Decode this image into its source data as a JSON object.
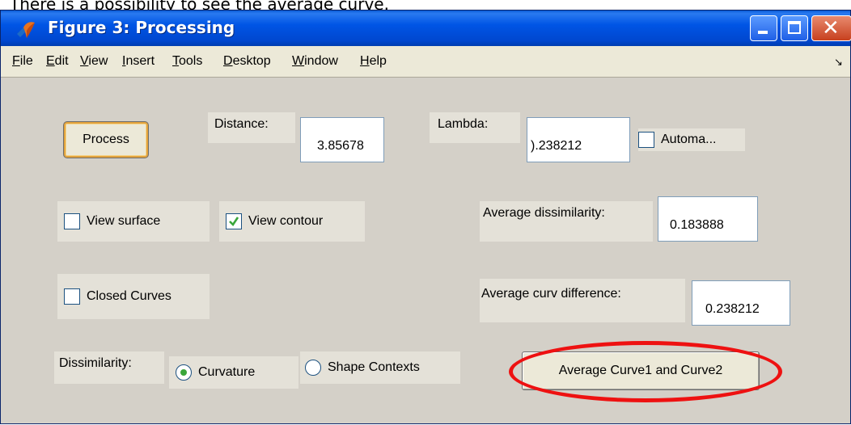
{
  "caption": "There is a possibility to see the average curve.",
  "window": {
    "title": "Figure 3: Processing",
    "controls": {
      "minimize": "minimize",
      "maximize": "maximize",
      "close": "close"
    }
  },
  "menu": [
    {
      "text": "File",
      "underline": "F",
      "rest": "ile"
    },
    {
      "text": "Edit",
      "underline": "E",
      "rest": "dit"
    },
    {
      "text": "View",
      "underline": "V",
      "rest": "iew"
    },
    {
      "text": "Insert",
      "underline": "I",
      "rest": "nsert"
    },
    {
      "text": "Tools",
      "underline": "T",
      "rest": "ools"
    },
    {
      "text": "Desktop",
      "underline": "D",
      "rest": "esktop"
    },
    {
      "text": "Window",
      "underline": "W",
      "rest": "indow"
    },
    {
      "text": "Help",
      "underline": "H",
      "rest": "elp"
    }
  ],
  "controls": {
    "process_label": "Process",
    "distance_label": "Distance:",
    "distance_value": "3.85678",
    "lambda_label": "Lambda:",
    "lambda_value": ").238212",
    "automatic_label": "Automa...",
    "automatic_checked": false,
    "view_surface_label": "View surface",
    "view_surface_checked": false,
    "view_contour_label": "View contour",
    "view_contour_checked": true,
    "closed_curves_label": "Closed Curves",
    "closed_curves_checked": false,
    "avg_dissimilarity_label": "Average dissimilarity:",
    "avg_dissimilarity_value": "0.183888",
    "avg_curv_diff_label": "Average curv difference:",
    "avg_curv_diff_value": "0.238212",
    "dissimilarity_label": "Dissimilarity:",
    "curvature_label": "Curvature",
    "curvature_selected": true,
    "shape_contexts_label": "Shape Contexts",
    "shape_contexts_selected": false,
    "avg_button_label": "Average Curve1 and Curve2"
  },
  "colors": {
    "titlebar": "#0055e5",
    "panel": "#d4d0c8",
    "highlight": "#ee1111",
    "check": "#3aa63a"
  }
}
